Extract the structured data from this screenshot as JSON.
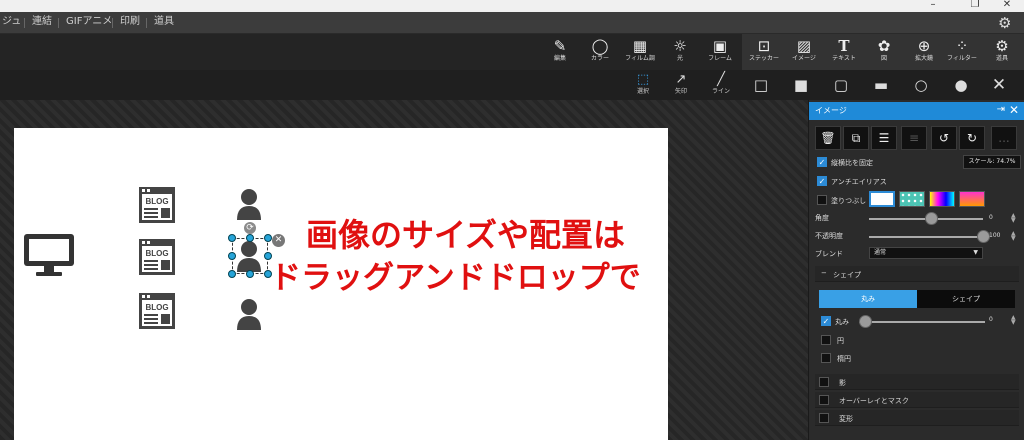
{
  "window": {
    "minimize": "–",
    "restore": "❐",
    "close": "✕"
  },
  "menu": {
    "items": [
      "ジュ",
      "連結",
      "GIFアニメ",
      "印刷",
      "道具"
    ],
    "settings_icon": "gear-icon"
  },
  "toolbar": {
    "tools": [
      {
        "label": "編集",
        "icon": "edit-icon",
        "glyph": "✎"
      },
      {
        "label": "カラー",
        "icon": "color-ring-icon",
        "glyph": "◯"
      },
      {
        "label": "フィルム調",
        "icon": "film-icon",
        "glyph": "▦"
      },
      {
        "label": "光",
        "icon": "light-icon",
        "glyph": "☼"
      },
      {
        "label": "フレーム",
        "icon": "frame-icon",
        "glyph": "▣"
      },
      {
        "label": "ステッカー",
        "icon": "sticker-icon",
        "glyph": "⊡"
      },
      {
        "label": "イメージ",
        "icon": "image-icon",
        "glyph": "▨"
      },
      {
        "label": "テキスト",
        "icon": "text-icon",
        "glyph": "T"
      },
      {
        "label": "図",
        "icon": "shape-icon",
        "glyph": "✿"
      },
      {
        "label": "拡大鏡",
        "icon": "magnifier-icon",
        "glyph": "⊕"
      },
      {
        "label": "フィルター",
        "icon": "filter-icon",
        "glyph": "⁘"
      },
      {
        "label": "道具",
        "icon": "tools-icon",
        "glyph": "⚙"
      }
    ]
  },
  "subtoolbar": {
    "tools": [
      {
        "label": "選択",
        "glyph": "⬚"
      },
      {
        "label": "矢印",
        "glyph": "↗"
      },
      {
        "label": "ライン",
        "glyph": "╱"
      }
    ],
    "shapes": [
      "□",
      "■",
      "▢",
      "▬",
      "○",
      "●"
    ],
    "close": "✕"
  },
  "canvas": {
    "text_line1": "画像のサイズや配置は",
    "text_line2": "ドラッグアンドドロップで",
    "blog_label": "BLOG",
    "text_color": "#e01010"
  },
  "panel": {
    "title": "イメージ",
    "pin": "⇥",
    "close": "✕",
    "buttons": [
      "🗑",
      "⧉",
      "☰",
      "≡",
      "↺",
      "↻",
      "..."
    ],
    "keep_ratio": "縦横比を固定",
    "scale": "スケール: 74.7%",
    "antialias": "アンチエイリアス",
    "fill": "塗りつぶし",
    "angle": {
      "label": "角度",
      "value": "0",
      "fraction": 0.55
    },
    "opacity": {
      "label": "不透明度",
      "value": "100",
      "fraction": 1.0
    },
    "blend": {
      "label": "ブレンド",
      "value": "通常"
    },
    "shape_section": "シェイプ",
    "shape_section_sign": "−",
    "seg_round": "丸み",
    "seg_shape": "シェイプ",
    "round_label": "丸み",
    "round_value": "0",
    "circle": "円",
    "ellipse": "楕円",
    "shadow": "影",
    "overlay_mask": "オーバーレイとマスク",
    "deform": "変形",
    "accent": "#1f8ad8"
  }
}
